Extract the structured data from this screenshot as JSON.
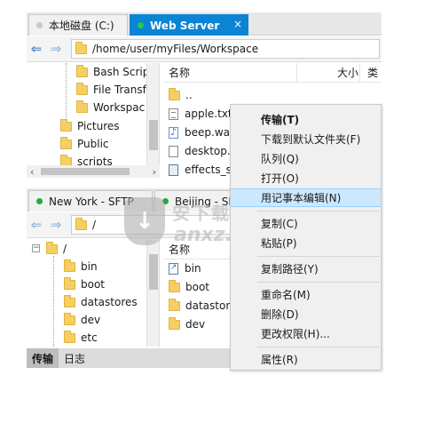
{
  "top_tabs": [
    {
      "label": "本地磁盘 (C:)",
      "dot_color": "#c8c8c8",
      "active": false
    },
    {
      "label": "Web Server",
      "dot_color": "#22cc44",
      "active": true,
      "close": "×"
    }
  ],
  "top_path": "/home/user/myFiles/Workspace",
  "top_tree": [
    "Bash Scrip",
    "File Transf",
    "Workspac",
    "Pictures",
    "Public",
    "scripts"
  ],
  "top_list": {
    "col_name": "名称",
    "col_size": "大小",
    "col_type": "类",
    "items": [
      {
        "name": "..",
        "icon": "folder-icon"
      },
      {
        "name": "apple.txt",
        "icon": "text-file-icon"
      },
      {
        "name": "beep.wav",
        "icon": "audio-file-icon"
      },
      {
        "name": "desktop.",
        "icon": "file-icon"
      },
      {
        "name": "effects_sa",
        "icon": "executable-file-icon"
      }
    ]
  },
  "bottom_tabs": [
    {
      "label": "New York - SFTP",
      "dot_color": "#22aa44"
    },
    {
      "label": "Beijing - SF",
      "dot_color": "#22aa44"
    }
  ],
  "bottom_path": "/",
  "bottom_tree": [
    "/",
    "bin",
    "boot",
    "datastores",
    "dev",
    "etc"
  ],
  "bottom_list": {
    "col_name": "名称",
    "items": [
      {
        "name": "bin",
        "icon": "link-folder-icon"
      },
      {
        "name": "boot",
        "icon": "folder-icon"
      },
      {
        "name": "datastore",
        "icon": "folder-icon"
      },
      {
        "name": "dev",
        "icon": "folder-icon"
      }
    ]
  },
  "status_tabs": [
    "传输",
    "日志"
  ],
  "context_menu": [
    {
      "label": "传输(T)",
      "bold": true
    },
    {
      "label": "下载到默认文件夹(F)"
    },
    {
      "label": "队列(Q)"
    },
    {
      "label": "打开(O)"
    },
    {
      "label": "用记事本编辑(N)",
      "highlighted": true
    },
    {
      "label": "复制(C)"
    },
    {
      "label": "粘贴(P)"
    },
    {
      "label": "复制路径(Y)"
    },
    {
      "label": "重命名(M)"
    },
    {
      "label": "删除(D)"
    },
    {
      "label": "更改权限(H)..."
    },
    {
      "label": "属性(R)"
    }
  ],
  "watermark": {
    "cn": "安下载",
    "en": "anxz.com"
  },
  "colors": {
    "accent": "#0b84d4",
    "folder": "#f5cf63",
    "menu_highlight": "#cce8ff"
  }
}
